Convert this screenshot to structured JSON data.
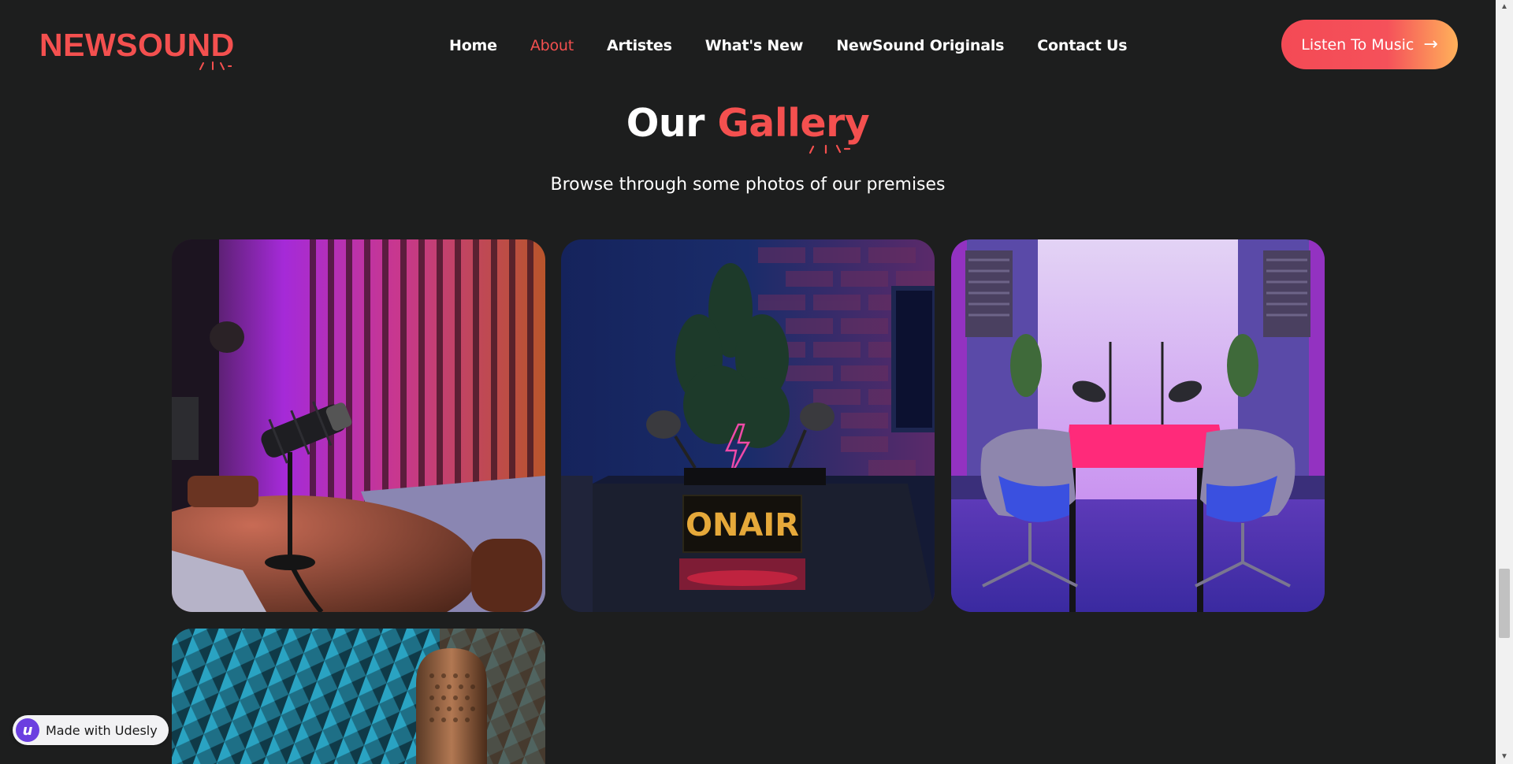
{
  "header": {
    "logo": "NEWSOUND",
    "nav": [
      {
        "label": "Home"
      },
      {
        "label": "About"
      },
      {
        "label": "Artistes"
      },
      {
        "label": "What's New"
      },
      {
        "label": "NewSound Originals"
      },
      {
        "label": "Contact Us"
      }
    ],
    "active_nav": "About",
    "cta_label": "Listen To Music",
    "cta_icon": "arrow-right-icon"
  },
  "gallery_section": {
    "title_plain": "Our",
    "title_accent": "Gallery",
    "subtitle": "Browse through some photos of our premises",
    "photos": [
      {
        "sign_text": ""
      },
      {
        "sign_text": "ONAIR"
      },
      {
        "sign_text": ""
      },
      {
        "sign_text": ""
      }
    ]
  },
  "badge": {
    "label": "Made with Udesly",
    "logo_letter": "u"
  },
  "colors": {
    "background": "#1d1e1e",
    "accent": "#f4504f",
    "cta_gradient_end": "#ffb15a",
    "text": "#ffffff"
  }
}
